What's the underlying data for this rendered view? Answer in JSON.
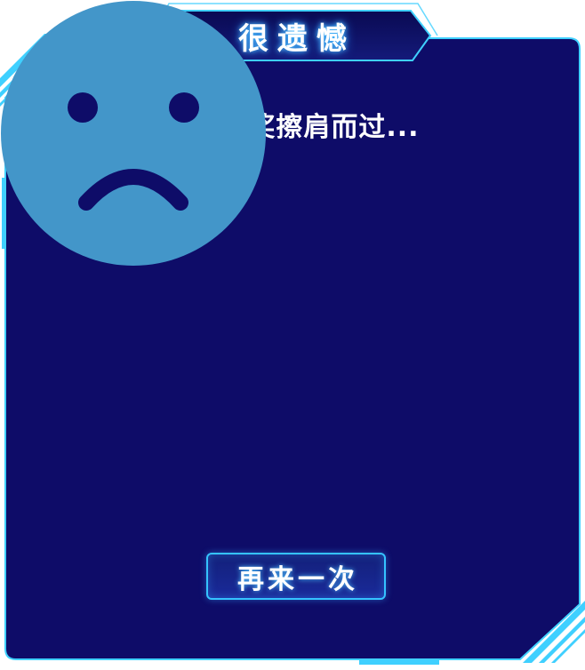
{
  "dialog": {
    "title": "很遗憾",
    "message": "您与大奖擦肩而过...",
    "retry_label": "再来一次",
    "face_icon": "sad-face-icon"
  },
  "colors": {
    "panel": "#0e0c68",
    "border": "#3fd0ff",
    "face": "#4396c9",
    "text": "#ffffff"
  }
}
